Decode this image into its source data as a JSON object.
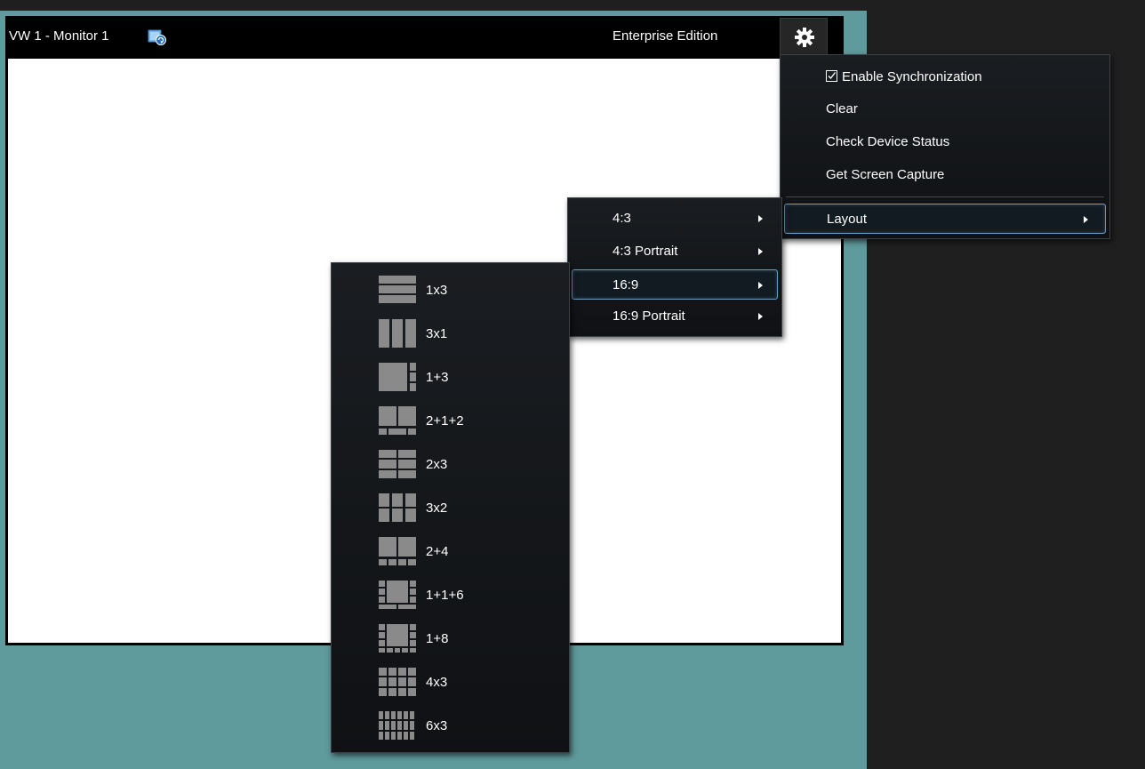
{
  "monitor": {
    "title": "VW 1 - Monitor 1",
    "edition": "Enterprise Edition",
    "sync_icon": "sync-icon",
    "settings_icon": "gear-icon"
  },
  "main_menu": {
    "enable_sync": {
      "label": "Enable Synchronization",
      "checked": true
    },
    "clear": "Clear",
    "check_device_status": "Check Device Status",
    "get_screen_capture": "Get Screen Capture",
    "layout": "Layout"
  },
  "aspect_menu": {
    "items": [
      "4:3",
      "4:3 Portrait",
      "16:9",
      "16:9 Portrait"
    ],
    "selected": "16:9"
  },
  "layout_menu": {
    "items": [
      "1x3",
      "3x1",
      "1+3",
      "2+1+2",
      "2x3",
      "3x2",
      "2+4",
      "1+1+6",
      "1+8",
      "4x3",
      "6x3"
    ]
  },
  "colors": {
    "background_teal": "#5f9a9c",
    "menu_bg": "#15181c",
    "selection_border": "#6c9ec4",
    "layout_icon_gray": "#8a8a8a"
  }
}
